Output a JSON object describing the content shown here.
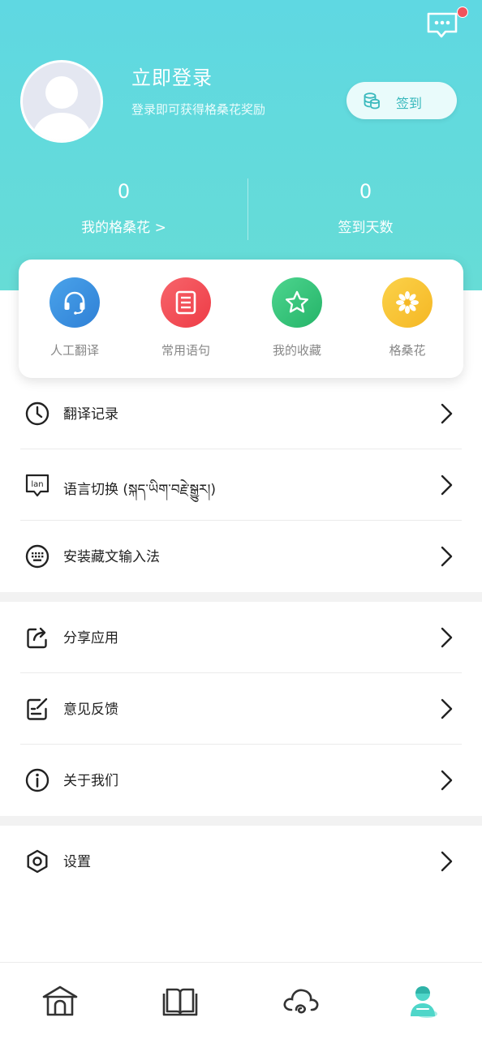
{
  "header": {
    "login_title": "立即登录",
    "login_subtitle": "登录即可获得格桑花奖励",
    "signin_label": "签到",
    "stats": [
      {
        "value": "0",
        "label": "我的格桑花 >"
      },
      {
        "value": "0",
        "label": "签到天数"
      }
    ],
    "has_unread_message": true
  },
  "quick_actions": [
    {
      "label": "人工翻译",
      "icon": "headset-icon",
      "color": "#3d93e0"
    },
    {
      "label": "常用语句",
      "icon": "document-icon",
      "color": "#f24c55"
    },
    {
      "label": "我的收藏",
      "icon": "star-icon",
      "color": "#33c47a"
    },
    {
      "label": "格桑花",
      "icon": "flower-icon",
      "color": "#f7c12d"
    }
  ],
  "menu_groups": [
    [
      {
        "label": "翻译记录",
        "icon": "clock-icon"
      },
      {
        "label": "语言切换 (སྐད་ཡིག་བརྗེ་སྒྱུར།)",
        "icon": "language-icon"
      },
      {
        "label": "安装藏文输入法",
        "icon": "keyboard-icon"
      }
    ],
    [
      {
        "label": "分享应用",
        "icon": "share-icon"
      },
      {
        "label": "意见反馈",
        "icon": "feedback-icon"
      },
      {
        "label": "关于我们",
        "icon": "info-icon"
      }
    ],
    [
      {
        "label": "设置",
        "icon": "settings-icon"
      }
    ]
  ],
  "language_icon_text": "lan",
  "tabbar": [
    {
      "name": "home-icon",
      "active": false
    },
    {
      "name": "book-icon",
      "active": false
    },
    {
      "name": "cloud-icon",
      "active": false
    },
    {
      "name": "profile-icon",
      "active": true
    }
  ],
  "colors": {
    "accent": "#5fd8e2",
    "active_tab": "#4fd6c9"
  }
}
